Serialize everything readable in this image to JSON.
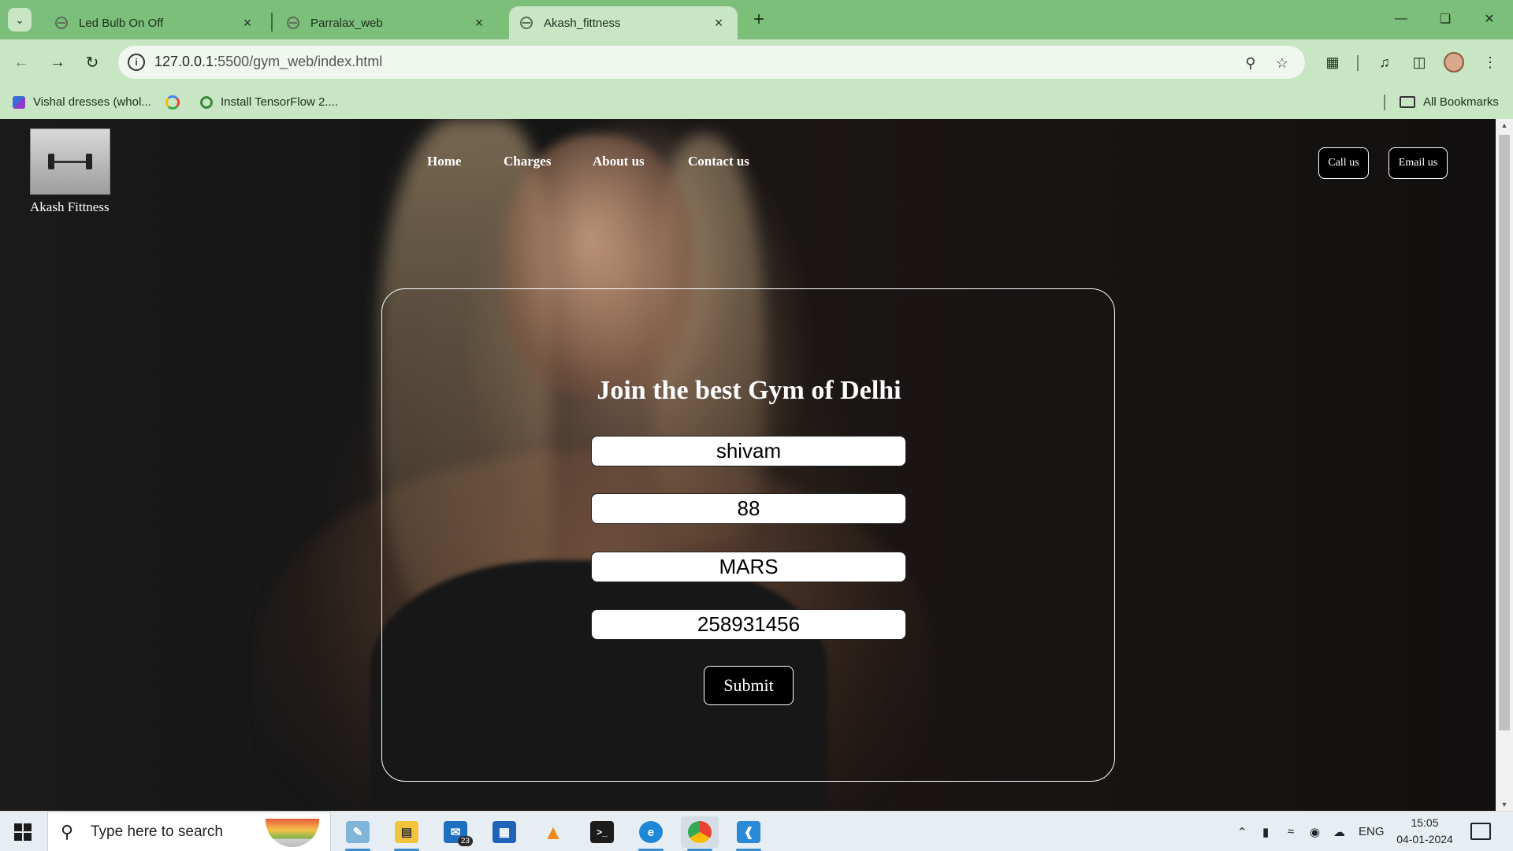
{
  "browser": {
    "tabs": [
      {
        "title": "Led Bulb On Off",
        "active": false
      },
      {
        "title": "Parralax_web",
        "active": false
      },
      {
        "title": "Akash_fittness",
        "active": true
      }
    ],
    "url_host": "127.0.0.1",
    "url_path": ":5500/gym_web/index.html",
    "bookmarks": [
      {
        "label": "Vishal dresses (whol...",
        "icon": "vishal-favicon"
      },
      {
        "label": "",
        "icon": "google-icon"
      },
      {
        "label": "Install TensorFlow 2....",
        "icon": "tensorflow-icon"
      }
    ],
    "all_bookmarks_label": "All Bookmarks"
  },
  "site": {
    "brand_name": "Akash Fittness",
    "nav": [
      "Home",
      "Charges",
      "About us",
      "Contact us"
    ],
    "call_label": "Call us",
    "email_label": "Email us",
    "form": {
      "heading": "Join the best Gym of Delhi",
      "name_value": "shivam",
      "age_value": "88",
      "address_value": "MARS",
      "phone_value": "258931456",
      "submit_label": "Submit"
    }
  },
  "taskbar": {
    "search_placeholder": "Type here to search",
    "mail_badge": "23",
    "language": "ENG",
    "time": "15:05",
    "date": "04-01-2024"
  },
  "colors": {
    "browser_frame": "#7cbf7b",
    "toolbar": "#c9e6c4",
    "page_text": "#ffffff",
    "button_bg": "#000000"
  }
}
